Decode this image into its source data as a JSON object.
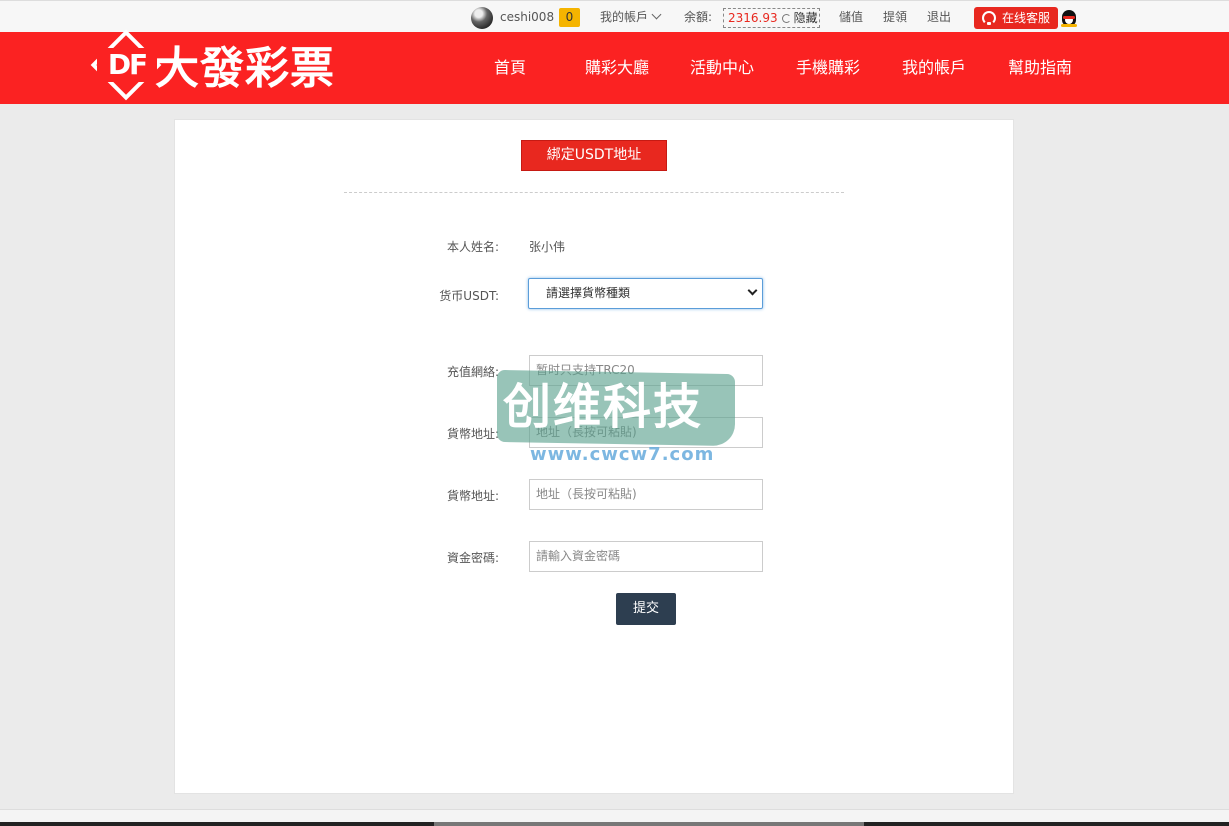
{
  "topbar": {
    "username": "ceshi008",
    "message_count": "0",
    "account_menu": "我的帳戶",
    "balance_label": "余額:",
    "balance_amount": "2316.93",
    "hide_label": "隐藏",
    "deposit": "儲值",
    "withdraw": "提領",
    "logout": "退出",
    "customer_service": "在线客服"
  },
  "brand": {
    "logo_mark": "DF",
    "logo_text": "大發彩票"
  },
  "nav": {
    "items": [
      "首頁",
      "購彩大廳",
      "活動中心",
      "手機購彩",
      "我的帳戶",
      "幫助指南"
    ]
  },
  "form": {
    "title": "綁定USDT地址",
    "name_label": "本人姓名:",
    "name_value": "张小伟",
    "currency_label": "货币USDT:",
    "currency_selected": "請選擇貨幣種類",
    "network_label": "充值網絡:",
    "network_placeholder": "暂时只支持TRC20",
    "address_label": "貨幣地址:",
    "address_placeholder": "地址（長按可粘貼)",
    "address2_label": "貨幣地址:",
    "address2_placeholder": "地址（長按可粘貼)",
    "password_label": "資金密碼:",
    "password_placeholder": "請輸入資金密碼",
    "submit": "提交"
  },
  "watermark": {
    "text": "创维科技",
    "url": "www.cwcw7.com"
  },
  "colors": {
    "brand_red": "#fb2222",
    "button_red": "#e8281f",
    "submit_navy": "#2d3e50",
    "badge_yellow": "#f5b400"
  }
}
